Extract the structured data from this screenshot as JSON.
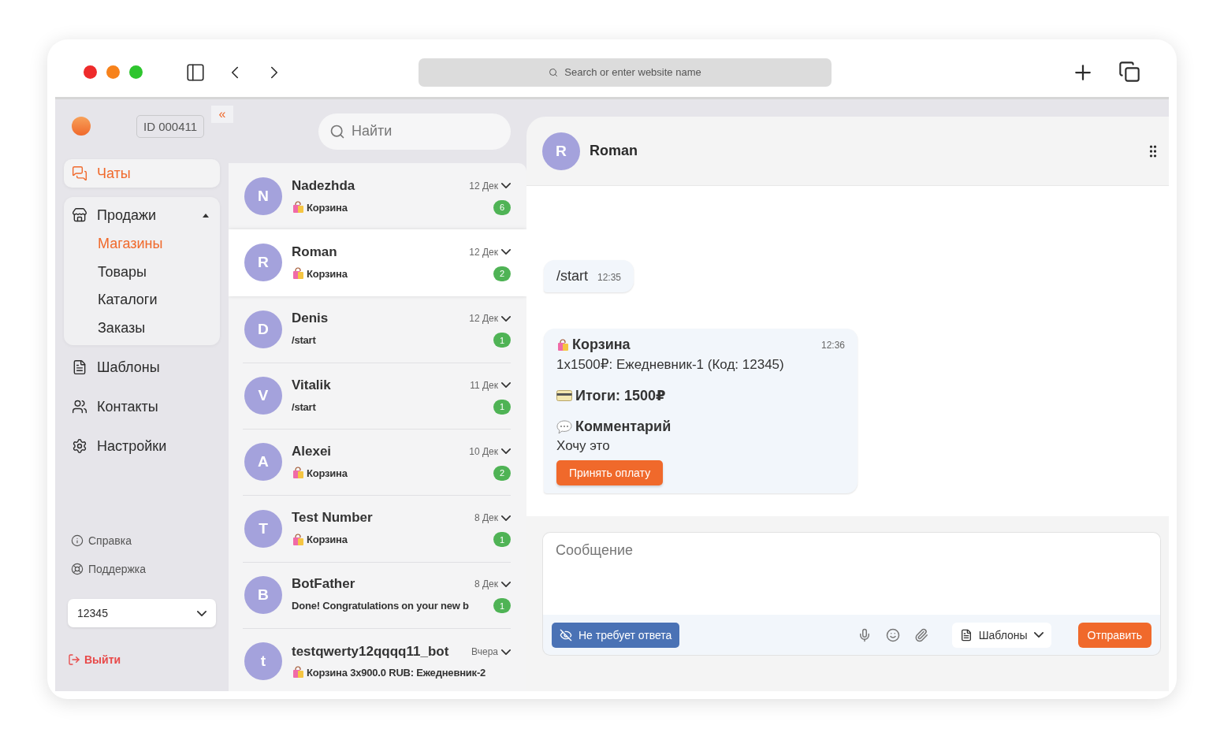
{
  "browser": {
    "address_placeholder": "Search or enter website name"
  },
  "sidebar": {
    "account_id": "ID 000411",
    "collapse": "«",
    "nav": [
      {
        "kind": "link",
        "label": "Чаты",
        "selected": true
      },
      {
        "kind": "group",
        "label": "Продажи",
        "selected": false,
        "expanded": true,
        "children": [
          {
            "label": "Магазины",
            "selected": true
          },
          {
            "label": "Товары",
            "selected": false
          },
          {
            "label": "Каталоги",
            "selected": false
          },
          {
            "label": "Заказы",
            "selected": false
          }
        ]
      },
      {
        "kind": "link",
        "label": "Шаблоны",
        "selected": false
      },
      {
        "kind": "link",
        "label": "Контакты",
        "selected": false
      },
      {
        "kind": "link",
        "label": "Настройки",
        "selected": false
      }
    ],
    "help_links": [
      {
        "label": "Справка"
      },
      {
        "label": "Поддержка"
      }
    ],
    "bot_select": {
      "value": "12345"
    },
    "logout": "Выйти"
  },
  "chat_list": {
    "search_placeholder": "Найти",
    "chats": [
      {
        "initial": "N",
        "name": "Nadezhda",
        "date": "12 Дек",
        "bag_icon": true,
        "preview": "Корзина",
        "unread": "6",
        "selected": false
      },
      {
        "initial": "R",
        "name": "Roman",
        "date": "12 Дек",
        "bag_icon": true,
        "preview": "Корзина",
        "unread": "2",
        "selected": true
      },
      {
        "initial": "D",
        "name": "Denis",
        "date": "12 Дек",
        "bag_icon": false,
        "preview": "/start",
        "unread": "1",
        "selected": false
      },
      {
        "initial": "V",
        "name": "Vitalik",
        "date": "11 Дек",
        "bag_icon": false,
        "preview": "/start",
        "unread": "1",
        "selected": false
      },
      {
        "initial": "A",
        "name": "Alexei",
        "date": "10 Дек",
        "bag_icon": true,
        "preview": "Корзина",
        "unread": "2",
        "selected": false
      },
      {
        "initial": "T",
        "name": "Test Number",
        "date": "8 Дек",
        "bag_icon": true,
        "preview": "Корзина",
        "unread": "1",
        "selected": false
      },
      {
        "initial": "B",
        "name": "BotFather",
        "date": "8 Дек",
        "bag_icon": false,
        "preview": "Done! Congratulations on your new b",
        "unread": "1",
        "selected": false
      },
      {
        "initial": "t",
        "name": "testqwerty12qqqq11_bot",
        "date": "Вчера",
        "bag_icon": true,
        "preview": "Корзина 3x900.0 RUB: Ежедневник-2",
        "selected": false
      }
    ]
  },
  "conversation": {
    "initial": "R",
    "name": "Roman",
    "messages": [
      {
        "kind": "text",
        "text": "/start",
        "time": "12:35"
      },
      {
        "kind": "order",
        "title": "Корзина",
        "line": "1x1500₽: Ежедневник-1 (Код: 12345)",
        "total": "Итоги: 1500₽",
        "comment_title": "Комментарий",
        "comment": "Хочу это",
        "button": "Принять оплату",
        "time": "12:36"
      }
    ],
    "composer": {
      "placeholder": "Сообщение",
      "no_reply": "Не требует ответа",
      "templates": "Шаблоны",
      "send": "Отправить"
    }
  }
}
